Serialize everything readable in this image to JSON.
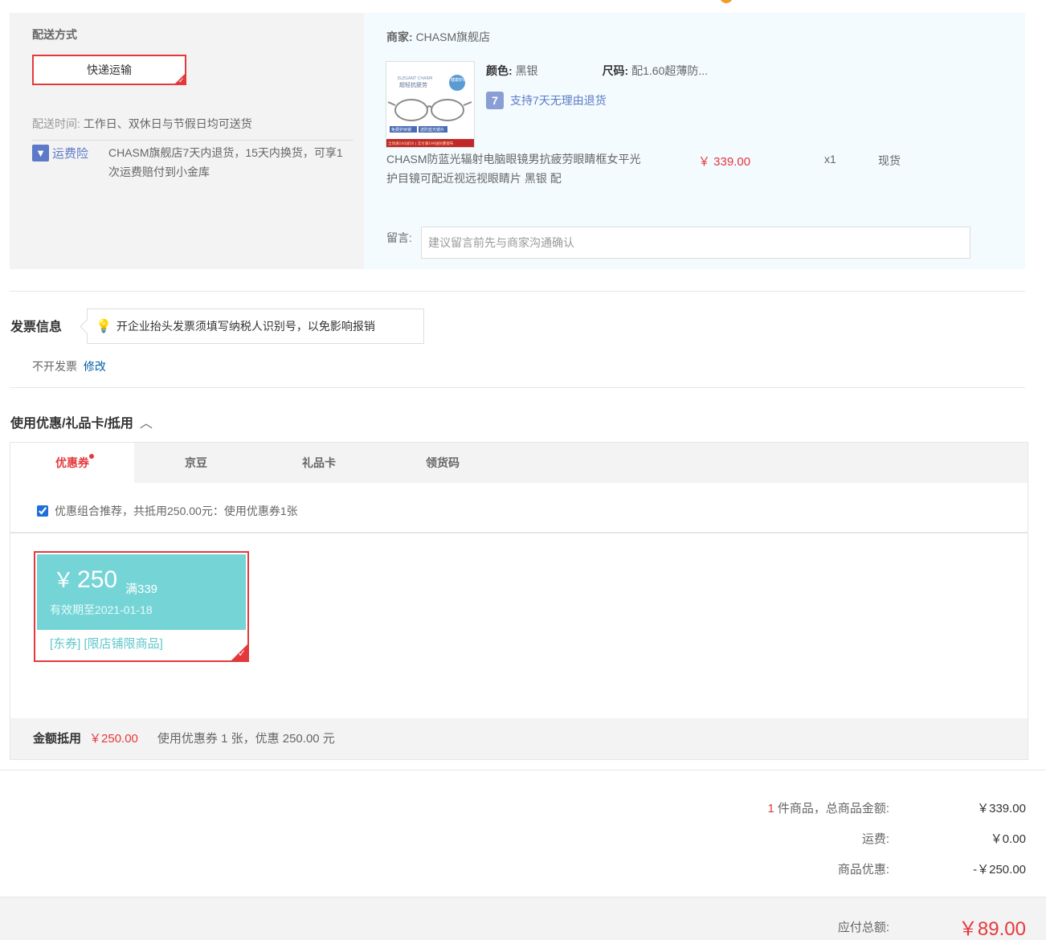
{
  "shipping": {
    "title": "配送方式",
    "method": "快递运输",
    "time_label": "配送时间:",
    "time_value": "工作日、双休日与节假日均可送货",
    "insurance_label": "运费险",
    "insurance_text": "CHASM旗舰店7天内退货，15天内换货，可享1次运费赔付到小金库"
  },
  "product": {
    "merchant_label": "商家:",
    "merchant_name": "CHASM旗舰店",
    "color_label": "颜色:",
    "color_value": "黑银",
    "size_label": "尺码:",
    "size_value": "配1.60超薄防...",
    "return_policy": "支持7天无理由退货",
    "name": "CHASM防蓝光辐射电脑眼镜男抗疲劳眼睛框女平光护目镜可配近视远视眼睛片 黑银 配",
    "price": "￥ 339.00",
    "qty": "x1",
    "stock": "现货",
    "img_brand": "ELEGANT CHARM",
    "img_tagline": "超轻抗疲劳",
    "img_badge": "健康护目",
    "img_band_a": "免费护目镜",
    "img_band_b": "送防蓝光镜片",
    "img_promo": "全场满100减50 | 实付满199送防雾镜布"
  },
  "remark": {
    "label": "留言:",
    "placeholder": "建议留言前先与商家沟通确认"
  },
  "invoice": {
    "title": "发票信息",
    "tip": "开企业抬头发票须填写纳税人识别号，以免影响报销",
    "status": "不开发票",
    "edit_label": "修改"
  },
  "coupon": {
    "title": "使用优惠/礼品卡/抵用",
    "tabs": [
      {
        "label": "优惠券"
      },
      {
        "label": "京豆"
      },
      {
        "label": "礼品卡"
      },
      {
        "label": "领货码"
      }
    ],
    "recommend_text": "优惠组合推荐，共抵用250.00元：使用优惠券1张",
    "card": {
      "yen": "￥",
      "amount": "250",
      "condition": "满339",
      "expiry": "有效期至2021-01-18",
      "tags": "[东券]  [限店铺限商品]"
    },
    "footer_label": "金额抵用",
    "footer_amount": "￥250.00",
    "footer_text": "使用优惠券 1 张，优惠 250.00 元"
  },
  "totals": {
    "count": "1",
    "items_label": "件商品，总商品金额:",
    "items_value": "￥339.00",
    "shipping_label": "运费:",
    "shipping_value": "￥0.00",
    "discount_label": "商品优惠:",
    "discount_value": "-￥250.00",
    "payable_label": "应付总额:",
    "payable_value": "￥89.00"
  },
  "colors": {
    "accent_red": "#e4393c",
    "link_blue": "#005ea7",
    "coupon_teal": "#75d4d6"
  }
}
